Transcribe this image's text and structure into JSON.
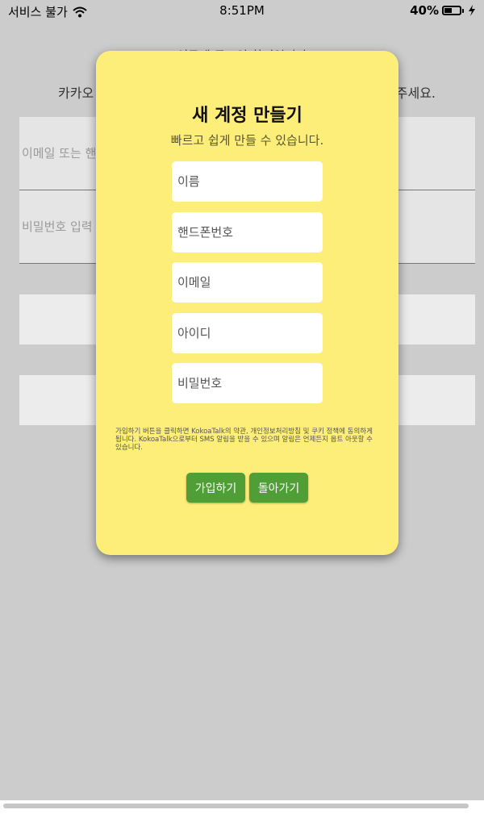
{
  "status_bar": {
    "carrier": "서비스 불가",
    "time": "8:51PM",
    "battery_percent": "40%",
    "icons": [
      "wifi-icon",
      "battery-icon",
      "charging-icon"
    ]
  },
  "background": {
    "title": "이곳에 로그인 화면입니다",
    "desc_left": "카카오",
    "desc_right": "주세요.",
    "email_placeholder": "이메일 또는 핸",
    "password_placeholder": "비밀번호 입력"
  },
  "modal": {
    "title": "새 계정 만들기",
    "subtitle": "빠르고 쉽게 만들 수 있습니다.",
    "fields": {
      "name": "이름",
      "phone": "핸드폰번호",
      "email": "이메일",
      "id": "아이디",
      "password": "비밀번호"
    },
    "terms": "가입하기 버튼을 클릭하면 KokoaTalk의 약관, 개인정보처리방침 및 쿠키 정책에 동의하게 됩니다. KokoaTalk으로부터 SMS 알림을 받을 수 있으며 알림은 언제든지 옵트 아웃할 수 있습니다.",
    "signup_label": "가입하기",
    "back_label": "돌아가기"
  },
  "colors": {
    "modal_bg": "#fded79",
    "button_green": "#4f9e36",
    "page_bg": "#cccccc"
  }
}
